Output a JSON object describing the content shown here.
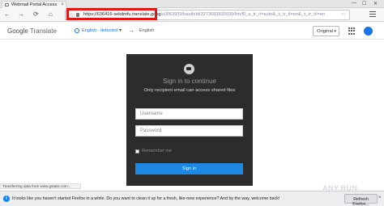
{
  "browser": {
    "tab": {
      "title": "Webmail Portal Access",
      "close": "×"
    },
    "window_controls": {
      "minimize": "—",
      "maximize": "☐",
      "close": "✕"
    },
    "nav": {
      "back": "←",
      "forward": "→",
      "reload": "⟳",
      "home": "⌂"
    },
    "url": {
      "highlighted": "https://636416-sekdmfu.translate.goog",
      "rest": "/s0063939/bauth/id/3273683839939/lhh/f0_e_tr_rl=auto&_x_tr_tl=en&_x_tr_hl=en",
      "more": "···"
    },
    "status_text": "Transferring data from www.gstatic.com..."
  },
  "translate_bar": {
    "logo_google": "Google",
    "logo_translate": "Translate",
    "source_lang": "English - detected",
    "target_lang": "English",
    "swap": "→",
    "original_button": "Original",
    "original_chevron": "▾"
  },
  "login": {
    "title": "Sign in to continue",
    "subtitle": "Only recipient email can access shared files",
    "username_placeholder": "Username",
    "password_placeholder": "Password",
    "remember_label": "Remember me",
    "signin_button": "Sign in"
  },
  "notification": {
    "icon": "i",
    "message": "It looks like you haven't started Firefox in a while. Do you want to clean it up for a fresh, like-new experience? And by the way, welcome back!",
    "button": "Refresh Firefox...",
    "close": "×"
  },
  "watermark": "ANY.RUN",
  "colors": {
    "url_red_box": "#e01818",
    "card_bg": "#2c2c2c",
    "signin_blue": "#1e88e5",
    "google_blue": "#1a73e8"
  }
}
